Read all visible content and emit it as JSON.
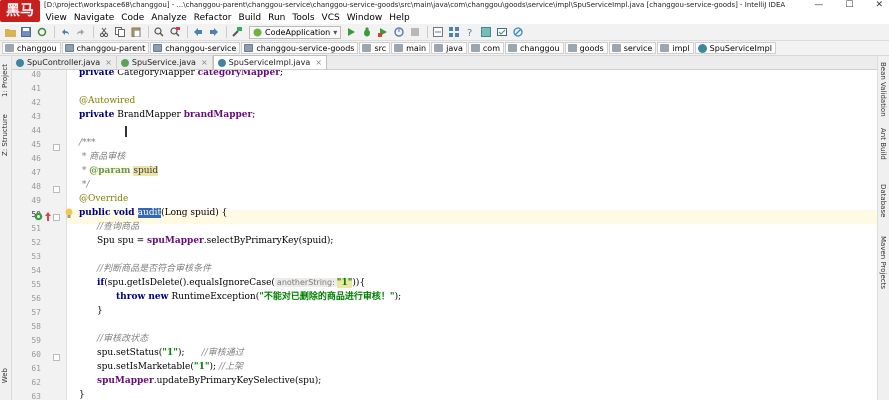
{
  "window": {
    "logo_text": "黑马",
    "title": "[D:\\project\\workspace68\\changgou] - ...\\changgou-parent\\changgou-service\\changgou-service-goods\\src\\main\\java\\com\\changgou\\goods\\service\\impl\\SpuServiceImpl.java [changgou-service-goods] - IntelliJ IDEA",
    "btn_min": "—",
    "btn_max": "☐",
    "btn_close": "✕"
  },
  "menu": [
    "View",
    "Navigate",
    "Code",
    "Analyze",
    "Refactor",
    "Build",
    "Run",
    "Tools",
    "VCS",
    "Window",
    "Help"
  ],
  "toolbar": {
    "run_config": "CodeApplication",
    "run_config_arrow": "▾"
  },
  "breadcrumb": [
    "changgou",
    "changgou-parent",
    "changgou-service",
    "changgou-service-goods",
    "src",
    "main",
    "java",
    "com",
    "changgou",
    "goods",
    "service",
    "impl",
    "SpuServiceImpl"
  ],
  "tabs": [
    {
      "label": "SpuController.java",
      "close": "×",
      "color": "#3e86a0"
    },
    {
      "label": "SpuService.java",
      "close": "×",
      "color": "#5aa25a"
    },
    {
      "label": "SpuServiceImpl.java",
      "close": "×",
      "color": "#3e86a0"
    }
  ],
  "left_panel": [
    "1: Project",
    "Z: Structure",
    "Web"
  ],
  "right_panel": [
    "Bean Validation",
    "Ant Build",
    "Database",
    "Maven Projects"
  ],
  "line_numbers": [
    "40",
    "41",
    "42",
    "43",
    "44",
    "45",
    "46",
    "47",
    "48",
    "49",
    "50",
    "51",
    "52",
    "53",
    "54",
    "55",
    "56",
    "57",
    "58",
    "59",
    "60",
    "61",
    "62",
    "63"
  ],
  "code": {
    "l40": {
      "kw": "private",
      "type": " CategoryMapper ",
      "field": "categoryMapper",
      "end": ";"
    },
    "l42": {
      "ann": "@Autowired"
    },
    "l43": {
      "kw": "private",
      "type": " BrandMapper ",
      "field": "brandMapper",
      "end": ";"
    },
    "l45": {
      "c": "/***"
    },
    "l46": {
      "c": " * 商品审核"
    },
    "l47": {
      "c1": " * ",
      "tag": "@param",
      "param": "spuid"
    },
    "l48": {
      "c": " */"
    },
    "l49": {
      "ann": "@Override"
    },
    "l50": {
      "kw1": "public",
      "kw2": " void ",
      "method": "audit",
      "rest": "(Long spuid) {"
    },
    "l51": {
      "c": "//查询商品"
    },
    "l52": {
      "pre": "Spu spu = ",
      "field": "spuMapper",
      "rest": ".selectByPrimaryKey(spuid);"
    },
    "l54": {
      "c": "//判断商品是否符合审核条件"
    },
    "l55": {
      "kw": "if",
      "pre": "(spu.getIsDelete().equalsIgnoreCase(",
      "hint": "anotherString:",
      "str": "\"1\"",
      "rest": ")){"
    },
    "l56": {
      "kw1": "throw",
      "kw2": " new ",
      "pre": "RuntimeException(",
      "str": "\"不能对已删除的商品进行审核！\"",
      "rest": ");"
    },
    "l57": {
      "text": "}"
    },
    "l59": {
      "c": "//审核改状态"
    },
    "l60": {
      "pre": "spu.setStatus(",
      "str": "\"1\"",
      "rest": ");      ",
      "c": "//审核通过"
    },
    "l61": {
      "pre": "spu.setIsMarketable(",
      "str": "\"1\"",
      "rest": "); ",
      "c": "//上架"
    },
    "l62": {
      "field": "spuMapper",
      "rest": ".updateByPrimaryKeySelective(spu);"
    },
    "l63": {
      "text": "}"
    }
  }
}
